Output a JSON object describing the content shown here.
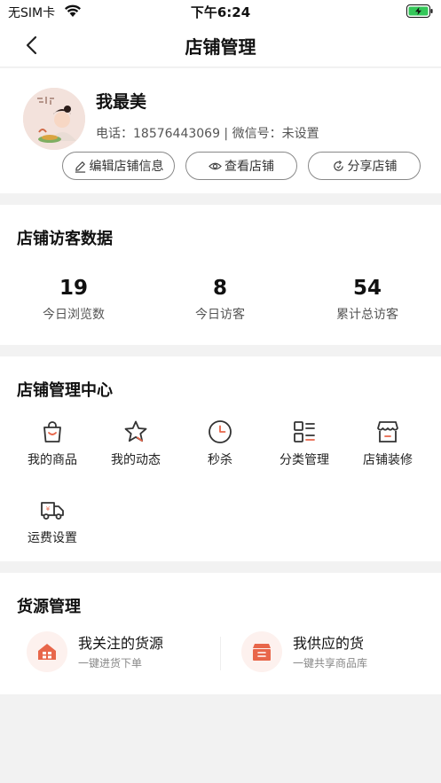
{
  "status_bar": {
    "carrier": "无SIM卡",
    "time": "下午6:24"
  },
  "nav": {
    "title": "店铺管理"
  },
  "profile": {
    "name": "我最美",
    "contact": "电话：18576443069 | 微信号：未设置",
    "actions": {
      "edit": "编辑店铺信息",
      "view": "查看店铺",
      "share": "分享店铺"
    }
  },
  "visitors": {
    "title": "店铺访客数据",
    "stats": [
      {
        "value": "19",
        "label": "今日浏览数"
      },
      {
        "value": "8",
        "label": "今日访客"
      },
      {
        "value": "54",
        "label": "累计总访客"
      }
    ]
  },
  "center": {
    "title": "店铺管理中心",
    "items": [
      {
        "label": "我的商品",
        "icon": "shopping-bag-icon"
      },
      {
        "label": "我的动态",
        "icon": "star-icon"
      },
      {
        "label": "秒杀",
        "icon": "clock-icon"
      },
      {
        "label": "分类管理",
        "icon": "category-list-icon"
      },
      {
        "label": "店铺装修",
        "icon": "storefront-icon"
      },
      {
        "label": "运费设置",
        "icon": "delivery-truck-icon"
      }
    ]
  },
  "supply": {
    "title": "货源管理",
    "items": [
      {
        "title": "我关注的货源",
        "subtitle": "一键进货下单",
        "icon": "house-icon"
      },
      {
        "title": "我供应的货",
        "subtitle": "一键共享商品库",
        "icon": "box-icon"
      }
    ]
  },
  "colors": {
    "accent": "#e8664a",
    "icon_dark": "#333333",
    "background": "#f2f2f2"
  }
}
